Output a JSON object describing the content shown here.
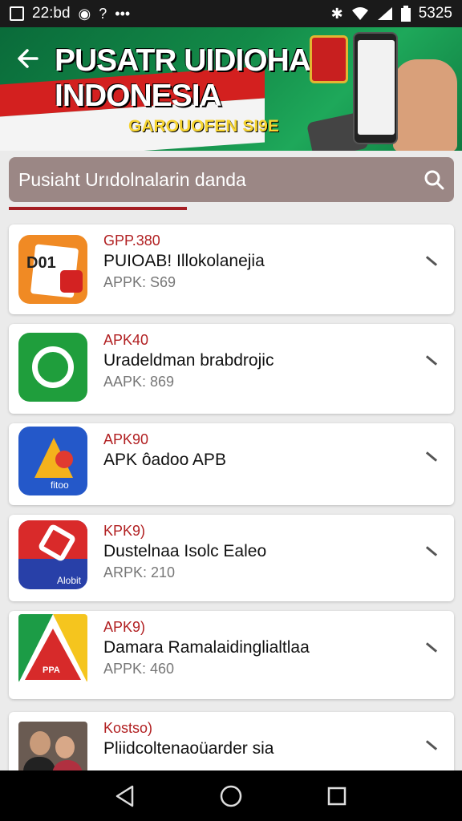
{
  "status_bar": {
    "time": "22:bd",
    "icons": [
      "image-icon",
      "alarm-icon",
      "help-icon",
      "more-icon"
    ],
    "right_text": "5325",
    "right_icons": [
      "bluetooth-icon",
      "wifi-icon",
      "signal-icon",
      "battery-icon"
    ]
  },
  "banner": {
    "title_line1": "PUSATR UIDIOHAN",
    "title_line2": "INDONESIA",
    "subtitle": "GAROUOFEN SI9E"
  },
  "search": {
    "text": "Pusiaht Urıdolnalarin danda"
  },
  "apps": [
    {
      "tag": "GPP.380",
      "title": "PUIOAB! Illokolanejia",
      "meta": "APPK: S69",
      "icon": "document-app-icon",
      "icon_text": "D01"
    },
    {
      "tag": "APK40",
      "title": "Uradeldman brabdrojic",
      "meta": "AAPK: 869",
      "icon": "whatsapp-style-app-icon",
      "icon_text": ""
    },
    {
      "tag": "APK90",
      "title": "APK ôadoo APB",
      "meta": "",
      "icon": "arrow-app-icon",
      "icon_text": "fitoo"
    },
    {
      "tag": "KPK9)",
      "title": "Dustelnaa Isolc Ealeo",
      "meta": "ARPK: 210",
      "icon": "red-flag-app-icon",
      "icon_text": "Alobit"
    },
    {
      "tag": "APK9)",
      "title": "Damara Ramalaidinglialtlaa",
      "meta": "APPK: 460",
      "icon": "triangle-app-icon",
      "icon_text": "PPA"
    },
    {
      "tag": "Kostso)",
      "title": "Pliidcoltenaoüarder sia",
      "meta": "",
      "icon": "people-photo-app-icon",
      "icon_text": ""
    }
  ],
  "colors": {
    "accent_red": "#b11f21",
    "banner_green": "#138a48",
    "search_bg": "#9b8785",
    "subtitle_yellow": "#f6d431"
  }
}
